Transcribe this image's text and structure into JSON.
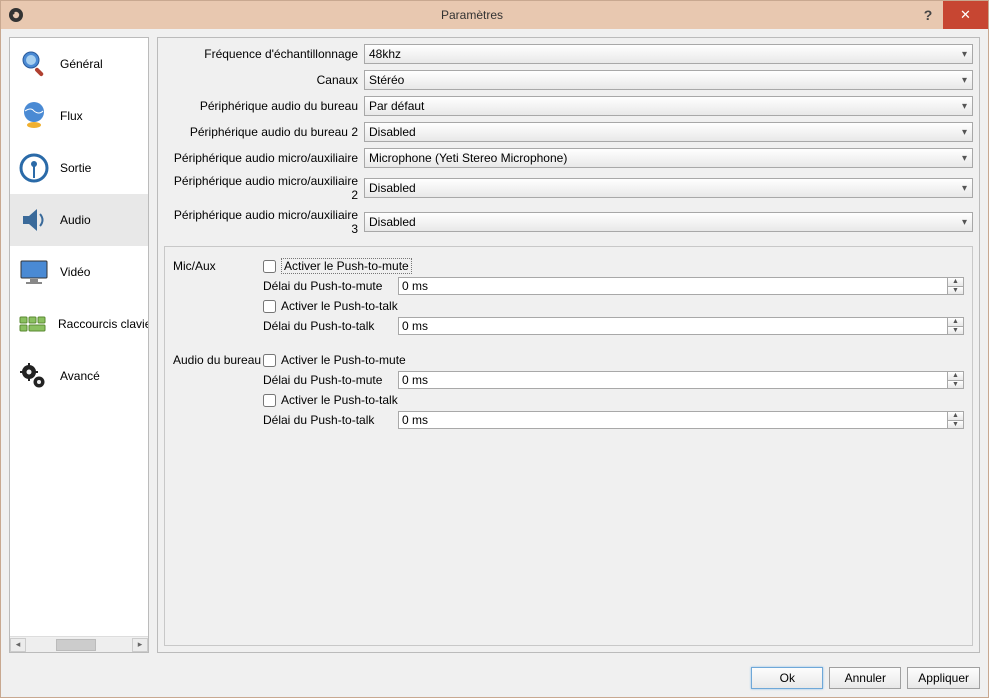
{
  "titlebar": {
    "title": "Paramètres",
    "help": "?",
    "close": "✕"
  },
  "sidebar": {
    "items": [
      {
        "label": "Général"
      },
      {
        "label": "Flux"
      },
      {
        "label": "Sortie"
      },
      {
        "label": "Audio"
      },
      {
        "label": "Vidéo"
      },
      {
        "label": "Raccourcis clavier"
      },
      {
        "label": "Avancé"
      }
    ]
  },
  "form": {
    "sample_rate_label": "Fréquence d'échantillonnage",
    "sample_rate_value": "48khz",
    "channels_label": "Canaux",
    "channels_value": "Stéréo",
    "desktop1_label": "Périphérique audio du bureau",
    "desktop1_value": "Par défaut",
    "desktop2_label": "Périphérique audio du bureau 2",
    "desktop2_value": "Disabled",
    "micaux1_label": "Périphérique audio micro/auxiliaire",
    "micaux1_value": "Microphone (Yeti Stereo Microphone)",
    "micaux2_label": "Périphérique audio micro/auxiliaire 2",
    "micaux2_value": "Disabled",
    "micaux3_label": "Périphérique audio micro/auxiliaire 3",
    "micaux3_value": "Disabled"
  },
  "groups": {
    "micaux": {
      "title": "Mic/Aux",
      "ptm_cb": "Activer le Push-to-mute",
      "ptm_delay_label": "Délai du Push-to-mute",
      "ptm_delay_value": "0 ms",
      "ptt_cb": "Activer le Push-to-talk",
      "ptt_delay_label": "Délai du Push-to-talk",
      "ptt_delay_value": "0 ms"
    },
    "desktop": {
      "title": "Audio du bureau",
      "ptm_cb": "Activer le Push-to-mute",
      "ptm_delay_label": "Délai du Push-to-mute",
      "ptm_delay_value": "0 ms",
      "ptt_cb": "Activer le Push-to-talk",
      "ptt_delay_label": "Délai du Push-to-talk",
      "ptt_delay_value": "0 ms"
    }
  },
  "footer": {
    "ok": "Ok",
    "cancel": "Annuler",
    "apply": "Appliquer"
  }
}
